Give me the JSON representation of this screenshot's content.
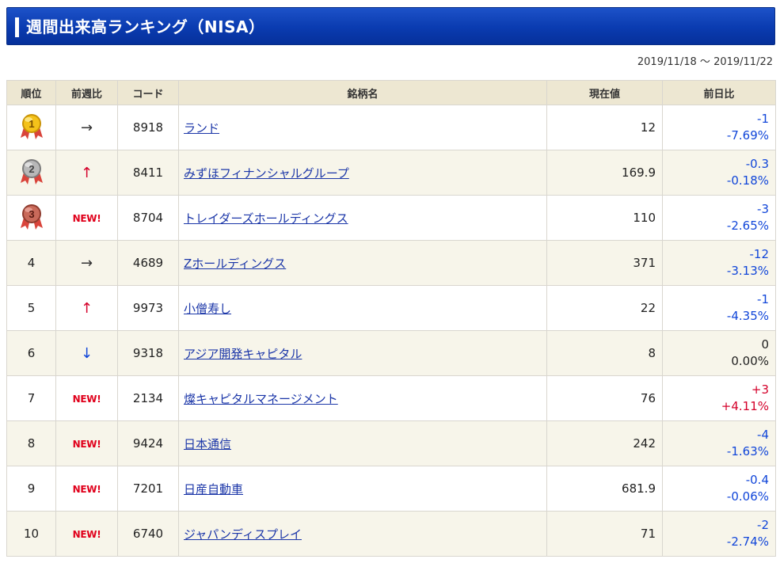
{
  "header": {
    "title": "週間出来高ランキング（NISA）"
  },
  "period": "2019/11/18 〜 2019/11/22",
  "columns": {
    "rank": "順位",
    "prev": "前週比",
    "code": "コード",
    "name": "銘柄名",
    "price": "現在値",
    "change": "前日比"
  },
  "colors": {
    "header_bg": "#0a3bb0",
    "table_head_bg": "#ede7d2",
    "row_alt_bg": "#f7f5ea",
    "negative": "#1146d9",
    "positive": "#d4002a",
    "link": "#1b36a8"
  },
  "rows": [
    {
      "rank": "1",
      "medal": "gold",
      "prev": "→",
      "prev_type": "same",
      "code": "8918",
      "name": "ランド",
      "price": "12",
      "change": "-1",
      "change_pct": "-7.69%",
      "dir": "neg"
    },
    {
      "rank": "2",
      "medal": "silver",
      "prev": "↑",
      "prev_type": "up",
      "code": "8411",
      "name": "みずほフィナンシャルグループ",
      "price": "169.9",
      "change": "-0.3",
      "change_pct": "-0.18%",
      "dir": "neg"
    },
    {
      "rank": "3",
      "medal": "bronze",
      "prev": "NEW!",
      "prev_type": "new",
      "code": "8704",
      "name": "トレイダーズホールディングス",
      "price": "110",
      "change": "-3",
      "change_pct": "-2.65%",
      "dir": "neg"
    },
    {
      "rank": "4",
      "medal": "",
      "prev": "→",
      "prev_type": "same",
      "code": "4689",
      "name": "Zホールディングス",
      "price": "371",
      "change": "-12",
      "change_pct": "-3.13%",
      "dir": "neg"
    },
    {
      "rank": "5",
      "medal": "",
      "prev": "↑",
      "prev_type": "up",
      "code": "9973",
      "name": "小僧寿し",
      "price": "22",
      "change": "-1",
      "change_pct": "-4.35%",
      "dir": "neg"
    },
    {
      "rank": "6",
      "medal": "",
      "prev": "↓",
      "prev_type": "down",
      "code": "9318",
      "name": "アジア開発キャピタル",
      "price": "8",
      "change": "0",
      "change_pct": "0.00%",
      "dir": "zero"
    },
    {
      "rank": "7",
      "medal": "",
      "prev": "NEW!",
      "prev_type": "new",
      "code": "2134",
      "name": "燦キャピタルマネージメント",
      "price": "76",
      "change": "+3",
      "change_pct": "+4.11%",
      "dir": "pos"
    },
    {
      "rank": "8",
      "medal": "",
      "prev": "NEW!",
      "prev_type": "new",
      "code": "9424",
      "name": "日本通信",
      "price": "242",
      "change": "-4",
      "change_pct": "-1.63%",
      "dir": "neg"
    },
    {
      "rank": "9",
      "medal": "",
      "prev": "NEW!",
      "prev_type": "new",
      "code": "7201",
      "name": "日産自動車",
      "price": "681.9",
      "change": "-0.4",
      "change_pct": "-0.06%",
      "dir": "neg"
    },
    {
      "rank": "10",
      "medal": "",
      "prev": "NEW!",
      "prev_type": "new",
      "code": "6740",
      "name": "ジャパンディスプレイ",
      "price": "71",
      "change": "-2",
      "change_pct": "-2.74%",
      "dir": "neg"
    }
  ]
}
